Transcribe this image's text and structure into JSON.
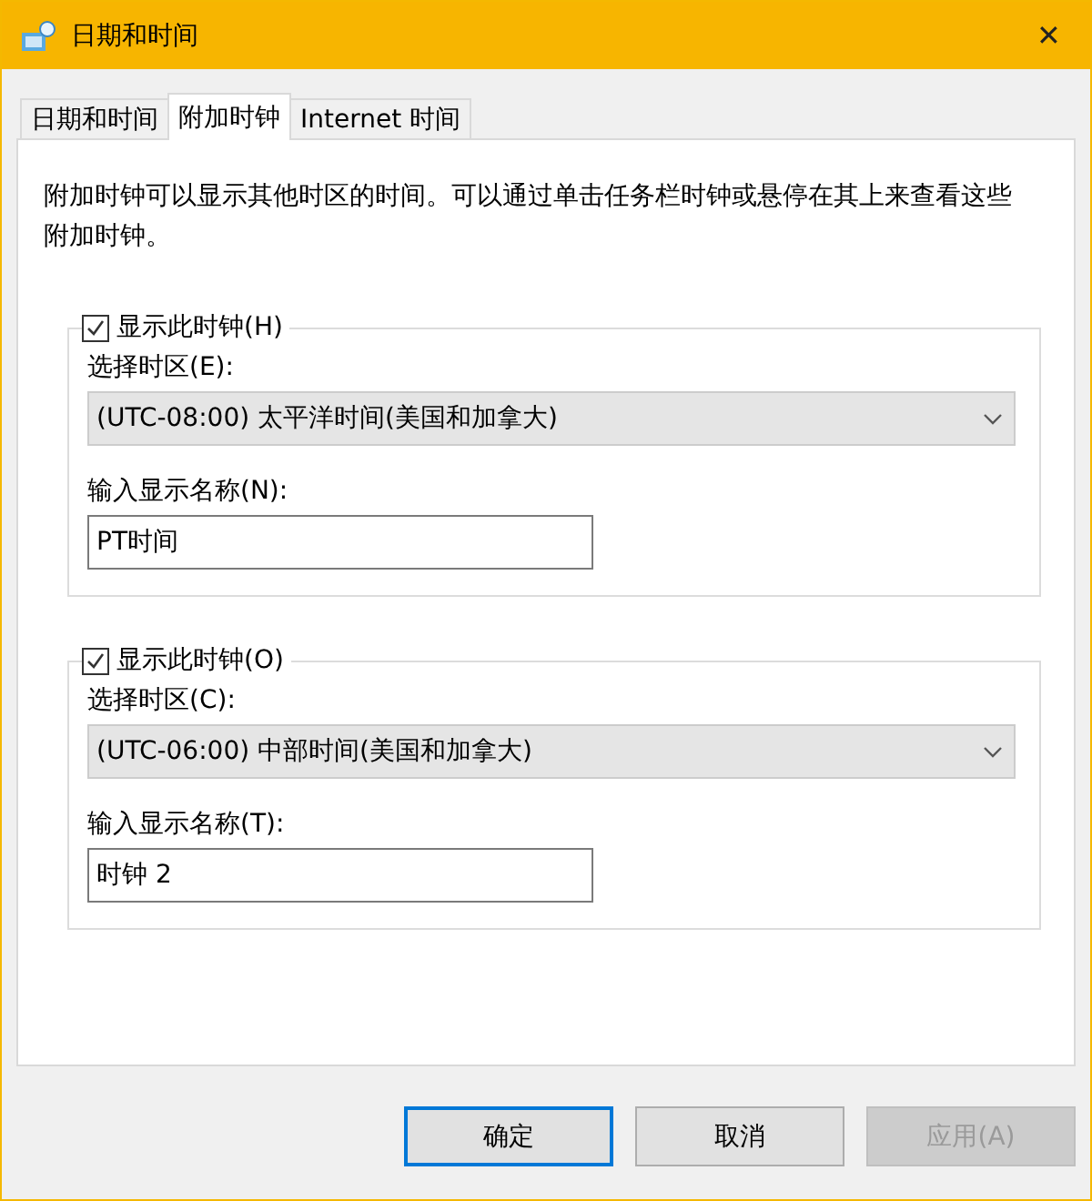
{
  "window": {
    "title": "日期和时间",
    "close": "✕"
  },
  "tabs": [
    {
      "label": "日期和时间",
      "selected": false
    },
    {
      "label": "附加时钟",
      "selected": true
    },
    {
      "label": "Internet 时间",
      "selected": false
    }
  ],
  "description": "附加时钟可以显示其他时区的时间。可以通过单击任务栏时钟或悬停在其上来查看这些附加时钟。",
  "clocks": [
    {
      "show_label": "显示此时钟(H)",
      "checked": true,
      "timezone_label": "选择时区(E):",
      "timezone": "(UTC-08:00) 太平洋时间(美国和加拿大)",
      "name_label": "输入显示名称(N):",
      "name": "PT时间"
    },
    {
      "show_label": "显示此时钟(O)",
      "checked": true,
      "timezone_label": "选择时区(C):",
      "timezone": "(UTC-06:00) 中部时间(美国和加拿大)",
      "name_label": "输入显示名称(T):",
      "name": "时钟 2"
    }
  ],
  "buttons": [
    {
      "label": "确定",
      "kind": "default",
      "disabled": false
    },
    {
      "label": "取消",
      "kind": "normal",
      "disabled": false
    },
    {
      "label": "应用(A)",
      "kind": "normal",
      "disabled": true
    }
  ]
}
